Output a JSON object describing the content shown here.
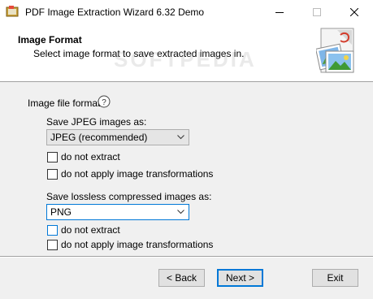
{
  "window": {
    "title": "PDF Image Extraction Wizard 6.32 Demo",
    "controls": [
      "minimize",
      "maximize",
      "close"
    ]
  },
  "header": {
    "title": "Image Format",
    "subtitle": "Select image format to save extracted images in.",
    "watermark": "SOFTPEDIA"
  },
  "section": {
    "label": "Image file formats",
    "help_icon": "help-icon"
  },
  "jpeg": {
    "label": "Save JPEG images as:",
    "selected": "JPEG (recommended)",
    "do_not_extract": {
      "label": "do not extract",
      "checked": false
    },
    "no_transform": {
      "label": "do not apply image transformations",
      "checked": false
    }
  },
  "lossless": {
    "label": "Save lossless compressed images as:",
    "selected": "PNG",
    "do_not_extract": {
      "label": "do not extract",
      "checked": false
    },
    "no_transform": {
      "label": "do not apply image transformations",
      "checked": false
    }
  },
  "buttons": {
    "back": "< Back",
    "next": "Next >",
    "exit": "Exit"
  },
  "colors": {
    "accent": "#0078d7",
    "background": "#f0f0f0"
  }
}
